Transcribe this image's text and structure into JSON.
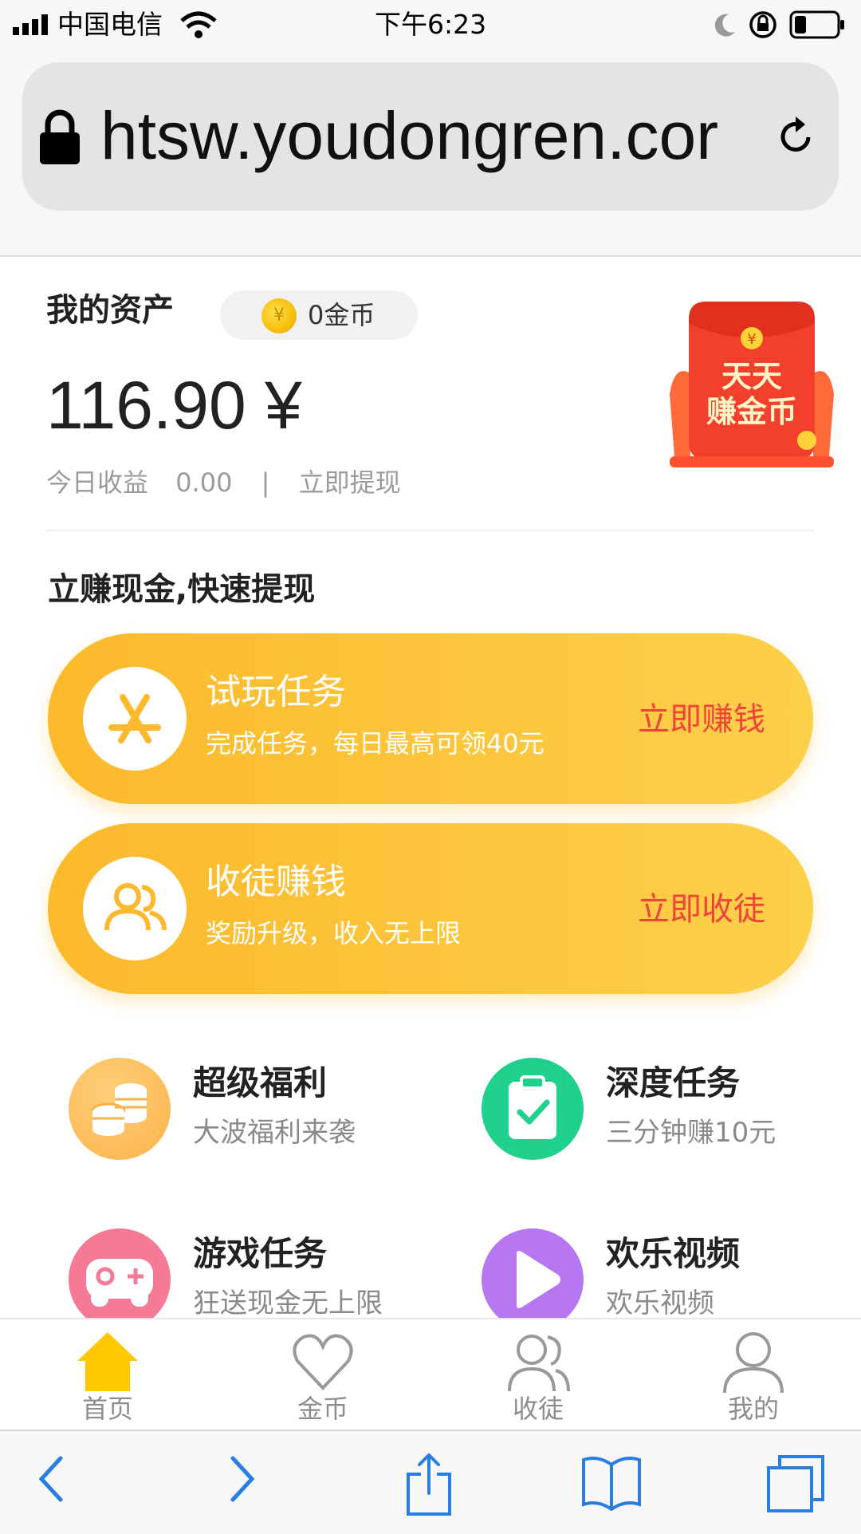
{
  "status_bar": {
    "carrier": "中国电信",
    "time": "下午6:23"
  },
  "browser": {
    "url": "htsw.youdongren.cor"
  },
  "assets": {
    "title": "我的资产",
    "coins": "0金币",
    "balance": "116.90 ¥",
    "today_label": "今日收益",
    "today_value": "0.00",
    "separator": "|",
    "withdraw_link": "立即提现",
    "promo_line1": "天天",
    "promo_line2": "赚金币"
  },
  "earn_section_title": "立赚现金,快速提现",
  "tasks": [
    {
      "title": "试玩任务",
      "subtitle": "完成任务，每日最高可领40元",
      "action": "立即赚钱"
    },
    {
      "title": "收徒赚钱",
      "subtitle": "奖励升级，收入无上限",
      "action": "立即收徒"
    }
  ],
  "features": [
    {
      "title": "超级福利",
      "subtitle": "大波福利来袭",
      "icon": "coins-stack-icon",
      "color": "#fbb24a"
    },
    {
      "title": "深度任务",
      "subtitle": "三分钟赚10元",
      "icon": "clipboard-check-icon",
      "color": "#1fd18c"
    },
    {
      "title": "游戏任务",
      "subtitle": "狂送现金无上限",
      "icon": "gamepad-icon",
      "color": "#f47a95"
    },
    {
      "title": "欢乐视频",
      "subtitle": "欢乐视频",
      "icon": "play-icon",
      "color": "#b777ee"
    }
  ],
  "tab_bar": [
    {
      "label": "首页",
      "icon": "home-icon",
      "active": true
    },
    {
      "label": "金币",
      "icon": "heart-icon",
      "active": false
    },
    {
      "label": "收徒",
      "icon": "users-icon",
      "active": false
    },
    {
      "label": "我的",
      "icon": "user-icon",
      "active": false
    }
  ],
  "colors": {
    "accent": "#fcb92c",
    "action_red": "#f04438",
    "home_yellow": "#ffc800"
  }
}
